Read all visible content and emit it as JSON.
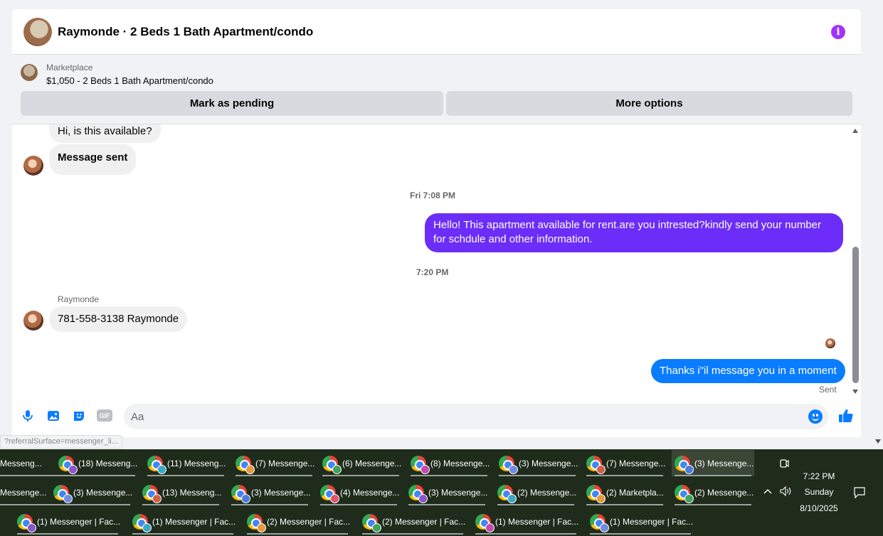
{
  "header": {
    "title": "Raymonde · 2 Beds 1 Bath Apartment/condo",
    "info_icon": "i"
  },
  "marketplace": {
    "label": "Marketplace",
    "listing": "$1,050 - 2 Beds 1 Bath Apartment/condo",
    "mark_pending": "Mark as pending",
    "more_options": "More options"
  },
  "thread": {
    "msg1": "Hi, is this available?",
    "msg2": "Message sent",
    "time1": "Fri 7:08 PM",
    "msg3": "Hello! This apartment available for rent.are you intrested?kindly send your number for schdule and other information.",
    "time2": "7:20 PM",
    "sender": "Raymonde",
    "msg4": "781-558-3138 Raymonde",
    "msg5": "Thanks i\"il message you in a moment",
    "status": "Sent"
  },
  "composer": {
    "placeholder": "Aa",
    "gif_label": "GIF"
  },
  "status_url": "?referralSurface=messenger_li...",
  "taskbar": {
    "row1": [
      "Messeng...",
      "(18) Messeng...",
      "(11) Messeng...",
      "(7) Messenge...",
      "(6) Messenge...",
      "(8) Messenge...",
      "(3) Messenge...",
      "(7) Messenge...",
      "(3) Messenge..."
    ],
    "row2": [
      "Messenge...",
      "(3) Messenge...",
      "(13) Messeng...",
      "(3) Messenge...",
      "(4) Messenge...",
      "(3) Messenge...",
      "(2) Messenge...",
      "(2) Marketpla...",
      "(2) Messenge..."
    ],
    "row3": [
      "(1) Messenger | Fac...",
      "(1) Messenger | Fac...",
      "(2) Messenger | Fac...",
      "(2) Messenger | Fac...",
      "(1) Messenger | Fac...",
      "(1) Messenger | Fac..."
    ],
    "time": "7:22 PM",
    "day": "Sunday",
    "date": "8/10/2025"
  },
  "colors": {
    "accent": "#0a7cff",
    "purple_bubble": "#6c2df8",
    "info": "#a033ff",
    "taskbar": "#1f2c1c"
  }
}
